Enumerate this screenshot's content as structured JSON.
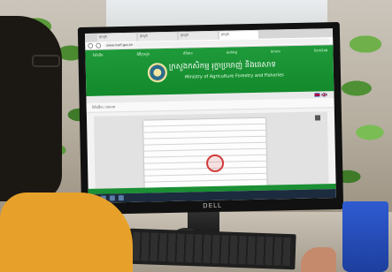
{
  "browser": {
    "tabs": [
      "ក្រសួង",
      "ក្រសួង",
      "ក្រសួង",
      "ក្រសួង"
    ],
    "url": "www.maff.gov.kh"
  },
  "site": {
    "nav": [
      "ទំព័រដើម",
      "អំពីក្រសួង",
      "ព័ត៌មាន",
      "សេវាកម្ម",
      "ឯកសារ",
      "ទំនាក់ទំនង"
    ],
    "title_km": "ក្រសួងកសិកម្ម រុក្ខាប្រមាញ់ និងនេសាទ",
    "title_en": "Ministry of Agriculture Forestry and Fisheries",
    "breadcrumb": "ទំព័រដើម / ឯកសារ"
  },
  "monitor": {
    "brand": "DELL"
  }
}
